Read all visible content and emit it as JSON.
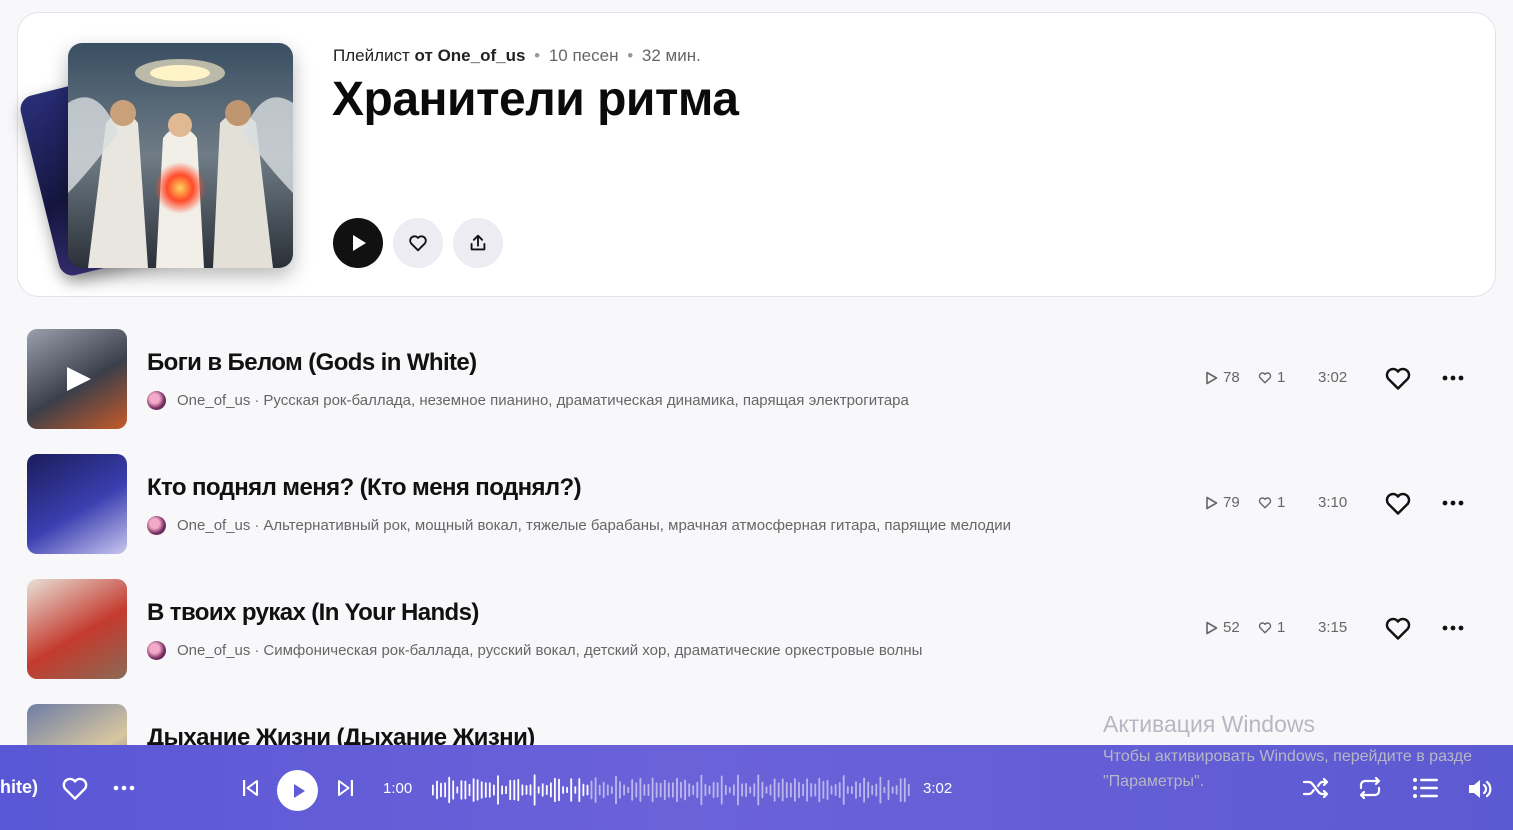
{
  "playlist": {
    "type_label": "Плейлист",
    "from_label": "от",
    "author": "One_of_us",
    "song_count": "10 песен",
    "duration": "32 мин.",
    "title": "Хранители ритма",
    "dot": "•"
  },
  "tracks": [
    {
      "title": "Боги в Белом (Gods in White)",
      "author": "One_of_us",
      "tags": "Русская рок-баллада, неземное пианино, драматическая динамика, парящая электрогитара",
      "plays": "78",
      "likes": "1",
      "duration": "3:02",
      "thumb_colors": [
        "#9aa0ac",
        "#3b3f4a",
        "#c75a2a"
      ]
    },
    {
      "title": "Кто поднял меня? (Кто меня поднял?)",
      "author": "One_of_us",
      "tags": "Альтернативный рок, мощный вокал, тяжелые барабаны, мрачная атмосферная гитара, парящие мелодии",
      "plays": "79",
      "likes": "1",
      "duration": "3:10",
      "thumb_colors": [
        "#1a1c5a",
        "#3b3fb0",
        "#c9c7f0"
      ]
    },
    {
      "title": "В твоих руках (In Your Hands)",
      "author": "One_of_us",
      "tags": "Симфоническая рок-баллада, русский вокал, детский хор, драматические оркестровые волны",
      "plays": "52",
      "likes": "1",
      "duration": "3:15",
      "thumb_colors": [
        "#e9e1d8",
        "#c43a2e",
        "#8a6a55"
      ]
    },
    {
      "title": "Дыхание Жизни (Дыхание Жизни)",
      "thumb_colors": [
        "#6d7ea5",
        "#d9c6a0",
        "#3a4c75"
      ]
    }
  ],
  "sep": "·",
  "player": {
    "current_title_fragment": "hite)",
    "elapsed": "1:00",
    "total": "3:02",
    "progress_fraction": 0.33
  },
  "overlay": {
    "title": "Активация Windows",
    "line1": "Чтобы активировать Windows, перейдите в разде",
    "line2": "\"Параметры\"."
  },
  "icons": {
    "play": "play-icon",
    "like": "heart-icon",
    "share": "share-icon",
    "more": "more-icon",
    "prev": "skip-back-icon",
    "next": "skip-forward-icon",
    "shuffle": "shuffle-icon",
    "repeat": "repeat-icon",
    "queue": "queue-icon",
    "volume": "volume-icon"
  },
  "colors": {
    "player_bg": "#5f5cd6",
    "accent_dark": "#111111"
  }
}
